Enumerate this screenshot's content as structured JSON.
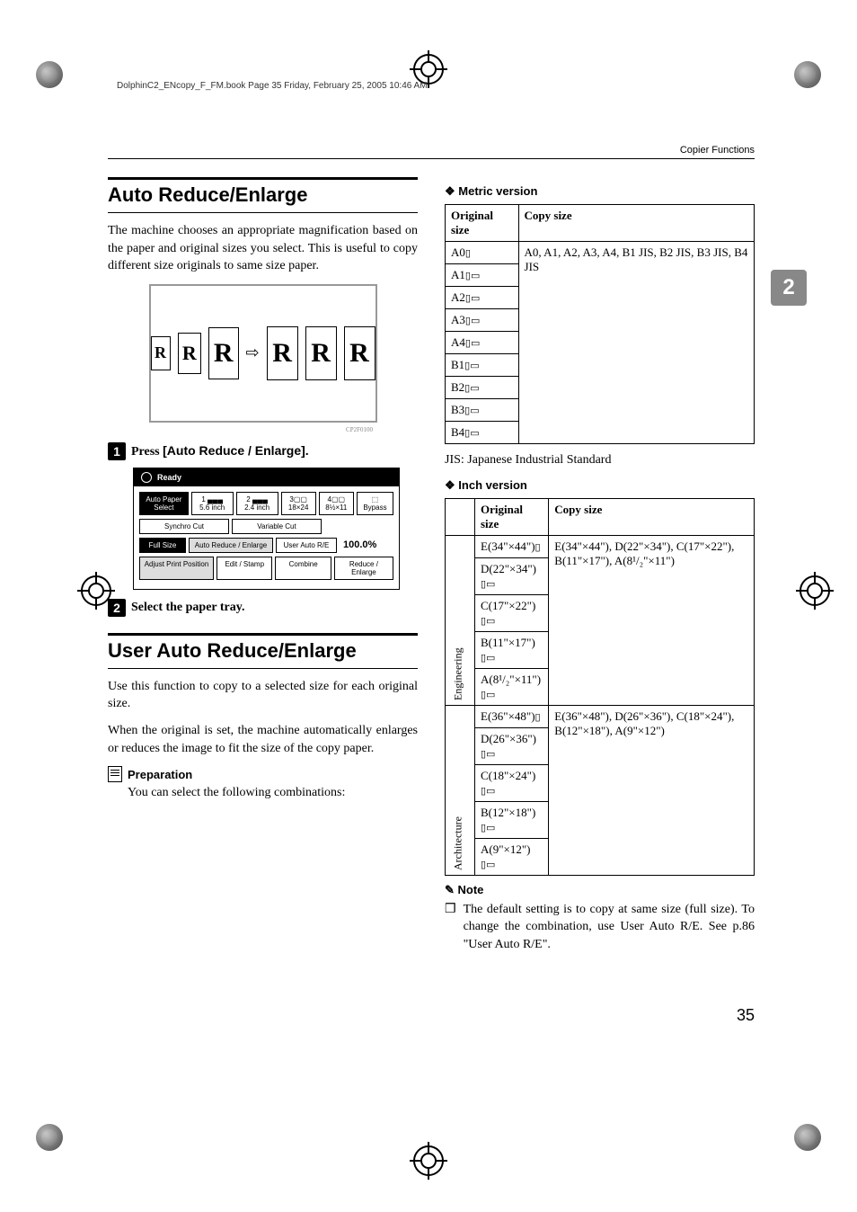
{
  "meta": {
    "book_header": "DolphinC2_ENcopy_F_FM.book  Page 35  Friday, February 25, 2005  10:46 AM",
    "running_head": "Copier Functions",
    "chapter_tab": "2",
    "page_number": "35"
  },
  "left": {
    "section1_title": "Auto Reduce/Enlarge",
    "section1_body": "The machine chooses an appropriate magnification based on the paper and original sizes you select. This is useful to copy different size originals to same size paper.",
    "diagram_letter": "R",
    "diagram_code": "CP2F0100",
    "step1_prefix": "Press ",
    "step1_bold": "[Auto Reduce / Enlarge].",
    "screenshot": {
      "ready": "Ready",
      "auto_paper": "Auto Paper Select",
      "t1a": "1",
      "t1b": "5.6 inch",
      "t2a": "2",
      "t2b": "2.4 inch",
      "t3": "3",
      "t3b": "18×24",
      "t4": "4",
      "t4b": "8½×11",
      "bypass": "Bypass",
      "synchro": "Synchro Cut",
      "varcut": "Variable Cut",
      "full": "Full Size",
      "are": "Auto Reduce / Enlarge",
      "user": "User Auto R/E",
      "pct": "100.0%",
      "adjust": "Adjust Print Position",
      "edit": "Edit / Stamp",
      "combine": "Combine",
      "re": "Reduce / Enlarge"
    },
    "step2_text": "Select the paper tray.",
    "section2_title": "User Auto Reduce/Enlarge",
    "section2_body1": "Use this function to copy to a selected size for each original size.",
    "section2_body2": "When the original is set, the machine automatically enlarges or reduces the image to fit the size of the copy paper.",
    "prep_title": "Preparation",
    "prep_body": "You can select the following combinations:"
  },
  "right": {
    "metric_heading": "Metric version",
    "metric_table": {
      "h1": "Original size",
      "h2": "Copy size",
      "r0": "A0",
      "r1": "A1",
      "r2": "A2",
      "r3": "A3",
      "r4": "A4",
      "r5": "B1",
      "r6": "B2",
      "r7": "B3",
      "r8": "B4",
      "copy": "A0, A1, A2, A3, A4, B1 JIS, B2 JIS, B3 JIS, B4 JIS"
    },
    "jis_note": "JIS: Japanese Industrial Standard",
    "inch_heading": "Inch version",
    "inch_table": {
      "h1": "Original size",
      "h2": "Copy size",
      "eng_label": "Engineering",
      "eng_r1": "E(34\"×44\")",
      "eng_r2": "D(22\"×34\")",
      "eng_r3": "C(17\"×22\")",
      "eng_r4": "B(11\"×17\")",
      "eng_r5": "A(8¹/₂\"×11\")",
      "eng_copy": "E(34\"×44\"), D(22\"×34\"), C(17\"×22\"), B(11\"×17\"), A(8¹/₂\"×11\")",
      "arch_label": "Architecture",
      "arch_r1": "E(36\"×48\")",
      "arch_r2": "D(26\"×36\")",
      "arch_r3": "C(18\"×24\")",
      "arch_r4": "B(12\"×18\")",
      "arch_r5": "A(9\"×12\")",
      "arch_copy": "E(36\"×48\"), D(26\"×36\"), C(18\"×24\"), B(12\"×18\"), A(9\"×12\")"
    },
    "note_heading": "Note",
    "note_bullet": "❒",
    "note_body": "The default setting is to copy at same size (full size). To change the combination, use User Auto R/E. See p.86 \"User Auto R/E\"."
  },
  "chart_data": {
    "type": "table",
    "title": "Auto Reduce/Enlarge — supported original→copy size combinations",
    "tables": [
      {
        "name": "Metric version",
        "original_sizes": [
          "A0",
          "A1",
          "A2",
          "A3",
          "A4",
          "B1",
          "B2",
          "B3",
          "B4"
        ],
        "copy_sizes": [
          "A0",
          "A1",
          "A2",
          "A3",
          "A4",
          "B1 JIS",
          "B2 JIS",
          "B3 JIS",
          "B4 JIS"
        ]
      },
      {
        "name": "Inch version — Engineering",
        "original_sizes": [
          "E(34\"×44\")",
          "D(22\"×34\")",
          "C(17\"×22\")",
          "B(11\"×17\")",
          "A(8 1/2\"×11\")"
        ],
        "copy_sizes": [
          "E(34\"×44\")",
          "D(22\"×34\")",
          "C(17\"×22\")",
          "B(11\"×17\")",
          "A(8 1/2\"×11\")"
        ]
      },
      {
        "name": "Inch version — Architecture",
        "original_sizes": [
          "E(36\"×48\")",
          "D(26\"×36\")",
          "C(18\"×24\")",
          "B(12\"×18\")",
          "A(9\"×12\")"
        ],
        "copy_sizes": [
          "E(36\"×48\")",
          "D(26\"×36\")",
          "C(18\"×24\")",
          "B(12\"×18\")",
          "A(9\"×12\")"
        ]
      }
    ]
  }
}
